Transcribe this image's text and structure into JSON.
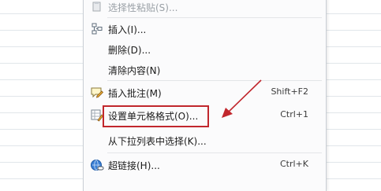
{
  "menu": {
    "items": [
      {
        "label": "选择性粘贴(S)...",
        "shortcut": "",
        "icon": "paste-special-icon",
        "disabled": true
      },
      {
        "label": "插入(I)...",
        "shortcut": "",
        "icon": "insert-icon",
        "disabled": false
      },
      {
        "label": "删除(D)...",
        "shortcut": "",
        "icon": "",
        "disabled": false
      },
      {
        "label": "清除内容(N)",
        "shortcut": "",
        "icon": "",
        "disabled": false
      },
      {
        "label": "插入批注(M)",
        "shortcut": "Shift+F2",
        "icon": "insert-comment-icon",
        "disabled": false
      },
      {
        "label": "设置单元格格式(O)...",
        "shortcut": "Ctrl+1",
        "icon": "format-cells-icon",
        "disabled": false
      },
      {
        "label": "从下拉列表中选择(K)...",
        "shortcut": "",
        "icon": "",
        "disabled": false
      },
      {
        "label": "超链接(H)...",
        "shortcut": "Ctrl+K",
        "icon": "hyperlink-icon",
        "disabled": false
      }
    ]
  },
  "annotation": {
    "highlight_color": "#c1272d",
    "highlighted_item": "设置单元格格式(O)..."
  }
}
